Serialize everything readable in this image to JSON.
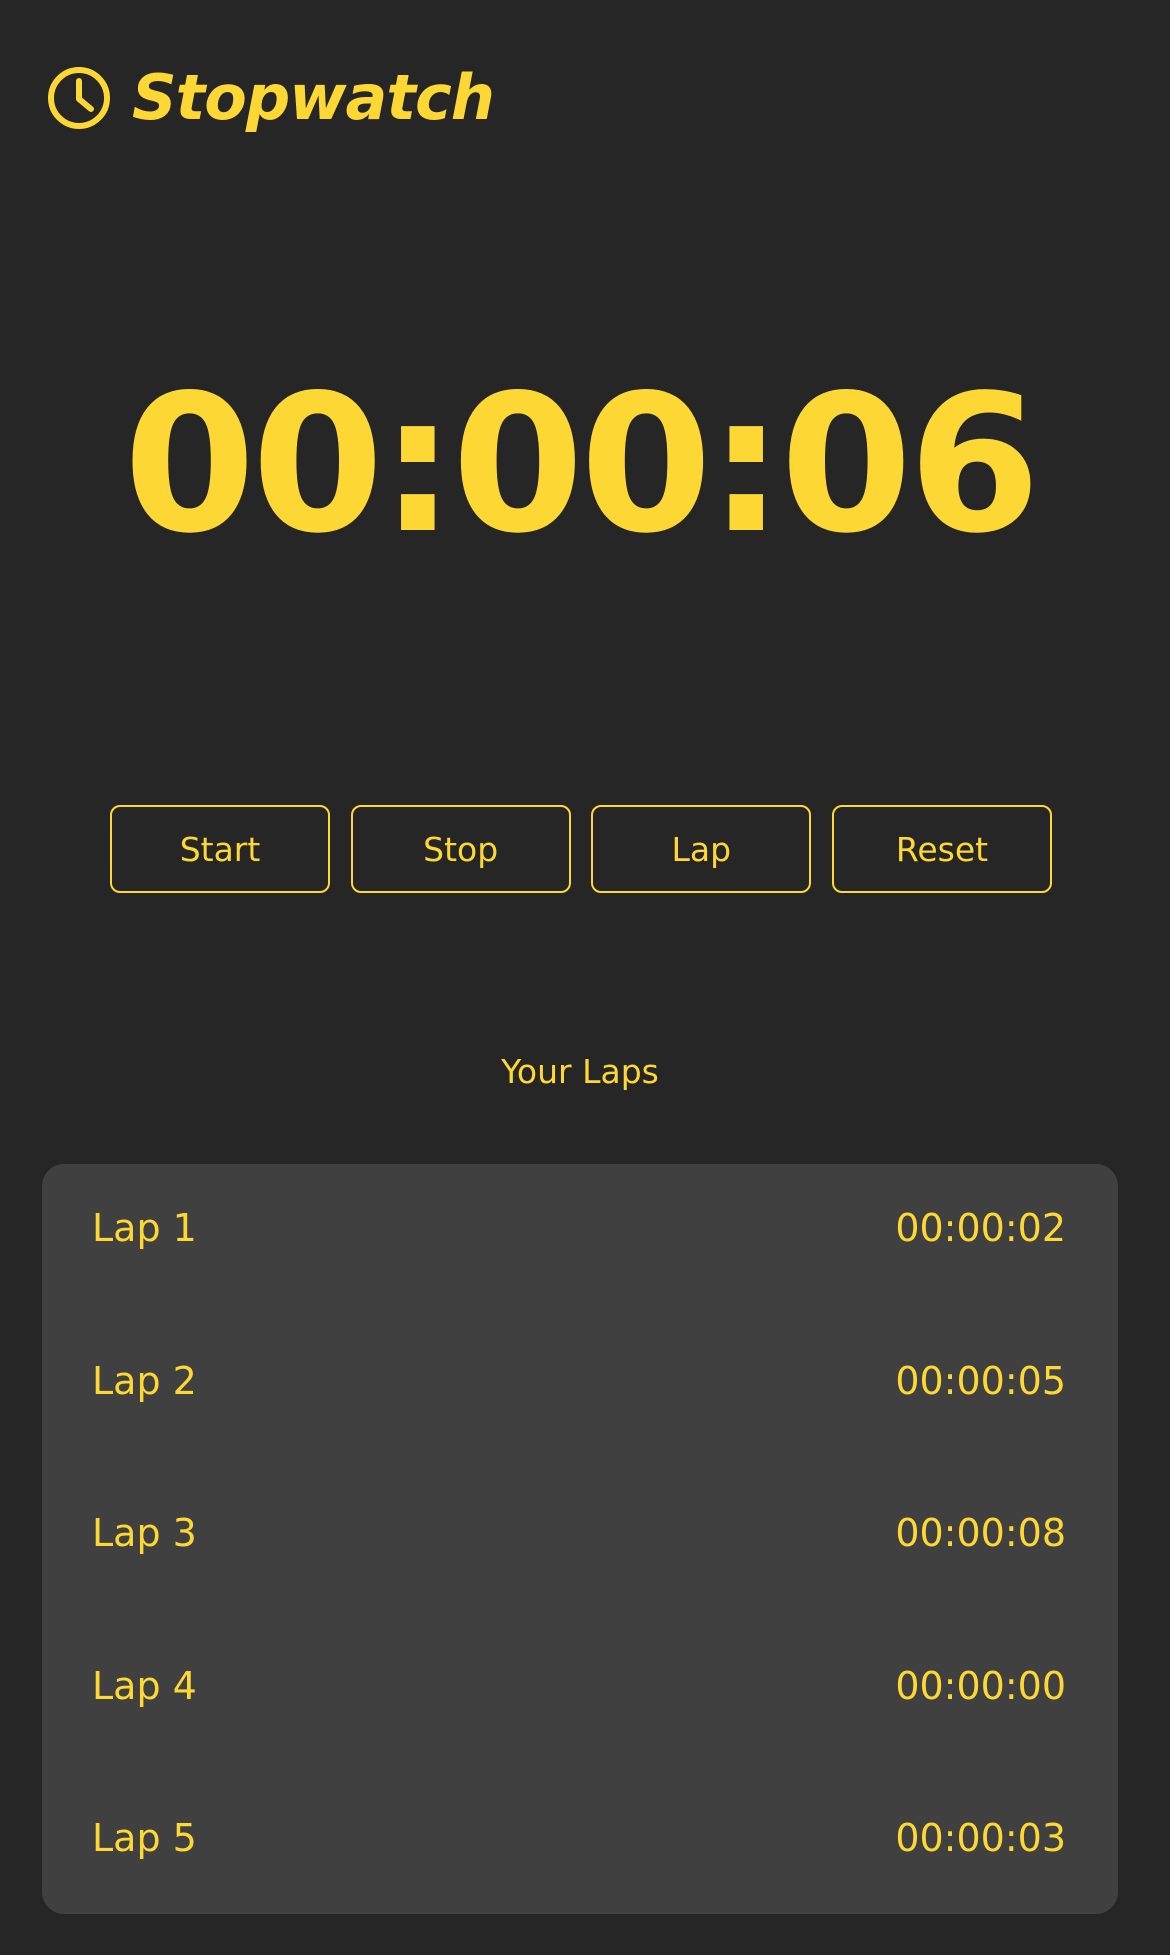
{
  "header": {
    "icon": "clock-icon",
    "title": "Stopwatch"
  },
  "timer": {
    "display": "00:00:06"
  },
  "controls": {
    "start_label": "Start",
    "stop_label": "Stop",
    "lap_label": "Lap",
    "reset_label": "Reset"
  },
  "laps": {
    "heading": "Your Laps",
    "items": [
      {
        "label": "Lap 1",
        "time": "00:00:02"
      },
      {
        "label": "Lap 2",
        "time": "00:00:05"
      },
      {
        "label": "Lap 3",
        "time": "00:00:08"
      },
      {
        "label": "Lap 4",
        "time": "00:00:00"
      },
      {
        "label": "Lap 5",
        "time": "00:00:03"
      }
    ]
  },
  "colors": {
    "background": "#262626",
    "card": "#404040",
    "accent": "#fdd835"
  }
}
